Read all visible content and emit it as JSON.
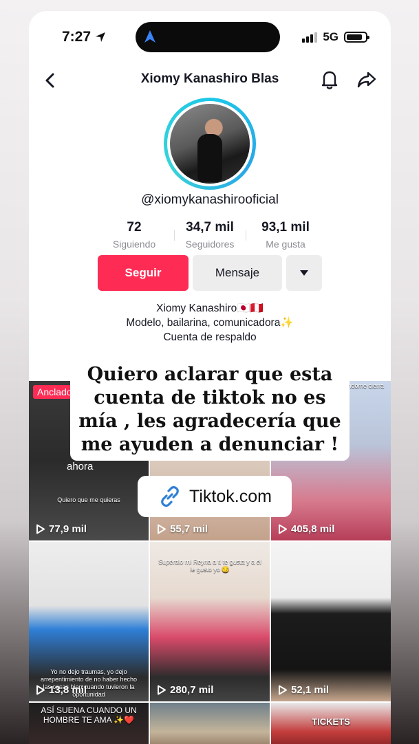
{
  "status": {
    "time": "7:27",
    "network": "5G"
  },
  "header": {
    "title": "Xiomy Kanashiro Blas"
  },
  "profile": {
    "handle": "@xiomykanashirooficial",
    "stats": [
      {
        "value": "72",
        "label": "Siguiendo"
      },
      {
        "value": "34,7 mil",
        "label": "Seguidores"
      },
      {
        "value": "93,1 mil",
        "label": "Me gusta"
      }
    ],
    "follow_label": "Seguir",
    "message_label": "Mensaje",
    "bio": [
      "Xiomy Kanashiro🇯🇵🇵🇪",
      "Modelo, bailarina, comunicadora✨",
      "Cuenta de respaldo"
    ]
  },
  "overlay": {
    "text": "Quiero aclarar que esta cuenta de tiktok no es mía , les agradecería que me ayuden a denunciar !",
    "link": "Tiktok.com"
  },
  "videos": [
    {
      "views": "77,9 mil",
      "badge": "Anclado",
      "extra": "ahora",
      "caption": "Quiero que me quieras"
    },
    {
      "views": "55,7 mil"
    },
    {
      "views": "405,8 mil",
      "caption": "amos ndome cierra"
    },
    {
      "views": "13,8 mil",
      "caption": "Yo no dejo traumas, yo dejo arrepentimiento de no haber hecho las cosas bien cuando tuvieron la oportunidad"
    },
    {
      "views": "280,7 mil",
      "caption": "Supéralo mi Reyna a ti te gusta y a él le gusto yo 😏"
    },
    {
      "views": "52,1 mil"
    },
    {
      "caption": "ASÍ SUENA CUANDO UN HOMBRE TE AMA ✨❤️"
    },
    {},
    {
      "caption": "TICKETS"
    }
  ],
  "colors": {
    "accent": "#fe2c55",
    "ring": "#1ec8e8"
  }
}
